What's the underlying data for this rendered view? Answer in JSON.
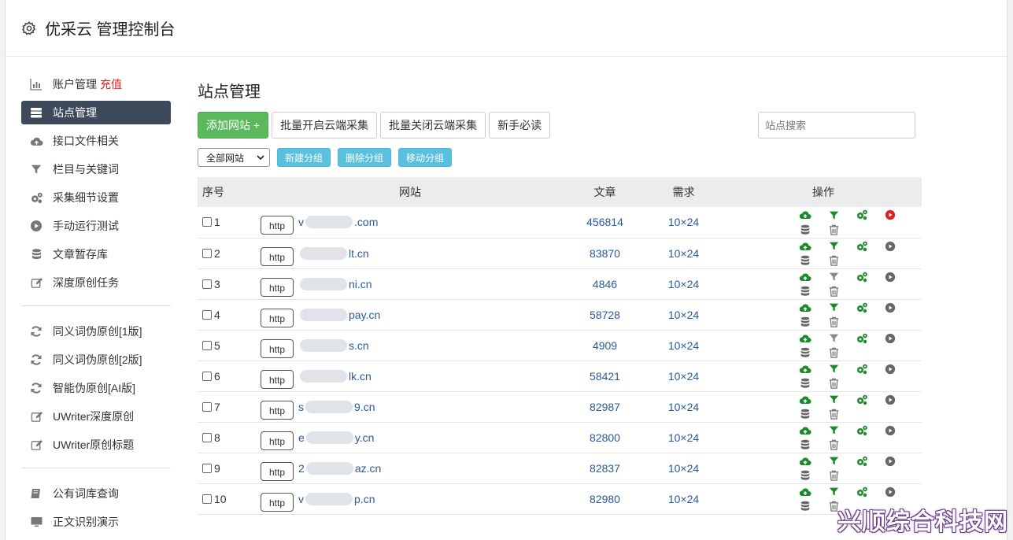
{
  "header": {
    "title": "优采云 管理控制台",
    "icon": "gear-icon"
  },
  "sidebar": {
    "groups": [
      [
        {
          "label": "账户管理",
          "extra": "充值",
          "icon": "bar-chart-icon",
          "active": false
        },
        {
          "label": "站点管理",
          "icon": "server-icon",
          "active": true
        },
        {
          "label": "接口文件相关",
          "icon": "cloud-upload-icon",
          "active": false
        },
        {
          "label": "栏目与关键词",
          "icon": "filter-icon",
          "active": false
        },
        {
          "label": "采集细节设置",
          "icon": "cogs-icon",
          "active": false
        },
        {
          "label": "手动运行测试",
          "icon": "play-circle-icon",
          "active": false
        },
        {
          "label": "文章暂存库",
          "icon": "database-icon",
          "active": false
        },
        {
          "label": "深度原创任务",
          "icon": "edit-icon",
          "active": false
        }
      ],
      [
        {
          "label": "同义词伪原创[1版]",
          "icon": "refresh-icon"
        },
        {
          "label": "同义词伪原创[2版]",
          "icon": "refresh-icon"
        },
        {
          "label": "智能伪原创[AI版]",
          "icon": "refresh-icon"
        },
        {
          "label": "UWriter深度原创",
          "icon": "edit-icon"
        },
        {
          "label": "UWriter原创标题",
          "icon": "edit-icon"
        }
      ],
      [
        {
          "label": "公有词库查询",
          "icon": "book-icon"
        },
        {
          "label": "正文识别演示",
          "icon": "monitor-icon"
        }
      ]
    ]
  },
  "main": {
    "title": "站点管理",
    "buttons": {
      "add_site": "添加网站 +",
      "batch_open": "批量开启云端采集",
      "batch_close": "批量关闭云端采集",
      "guide": "新手必读"
    },
    "search_placeholder": "站点搜索",
    "group_select": "全部网站",
    "group_buttons": {
      "new": "新建分组",
      "delete": "删除分组",
      "move": "移动分组"
    },
    "table": {
      "headers": {
        "no": "序号",
        "site": "网站",
        "articles": "文章",
        "demand": "需求",
        "ops": "操作"
      },
      "rows": [
        {
          "no": "1",
          "protocol": "http",
          "prefix": "v",
          "domain": ".com",
          "articles": "456814",
          "demand": "10×24",
          "filter_active": true,
          "running": true
        },
        {
          "no": "2",
          "protocol": "http",
          "prefix": "",
          "domain": "lt.cn",
          "articles": "83870",
          "demand": "10×24",
          "filter_active": true,
          "running": false
        },
        {
          "no": "3",
          "protocol": "http",
          "prefix": "",
          "domain": "ni.cn",
          "articles": "4846",
          "demand": "10×24",
          "filter_active": false,
          "running": false
        },
        {
          "no": "4",
          "protocol": "http",
          "prefix": "",
          "domain": "pay.cn",
          "articles": "58728",
          "demand": "10×24",
          "filter_active": true,
          "running": false
        },
        {
          "no": "5",
          "protocol": "http",
          "prefix": "",
          "domain": "s.cn",
          "articles": "4909",
          "demand": "10×24",
          "filter_active": false,
          "running": false
        },
        {
          "no": "6",
          "protocol": "http",
          "prefix": "",
          "domain": "lk.cn",
          "articles": "58421",
          "demand": "10×24",
          "filter_active": true,
          "running": false
        },
        {
          "no": "7",
          "protocol": "http",
          "prefix": "s",
          "domain": "9.cn",
          "articles": "82987",
          "demand": "10×24",
          "filter_active": true,
          "running": false
        },
        {
          "no": "8",
          "protocol": "http",
          "prefix": "e",
          "domain": "y.cn",
          "articles": "82800",
          "demand": "10×24",
          "filter_active": true,
          "running": false
        },
        {
          "no": "9",
          "protocol": "http",
          "prefix": "2",
          "domain": "az.cn",
          "articles": "82837",
          "demand": "10×24",
          "filter_active": true,
          "running": false
        },
        {
          "no": "10",
          "protocol": "http",
          "prefix": "v",
          "domain": "p.cn",
          "articles": "82980",
          "demand": "10×24",
          "filter_active": true,
          "running": false
        }
      ]
    }
  },
  "watermark": "兴顺综合科技网",
  "colors": {
    "active_nav": "#3d4a5c",
    "green": "#5cb85c",
    "info": "#5bc0de",
    "link": "#2a5a9b",
    "op_green": "#1a8a2a",
    "run_red": "#e02020",
    "recharge": "#d9231e"
  }
}
